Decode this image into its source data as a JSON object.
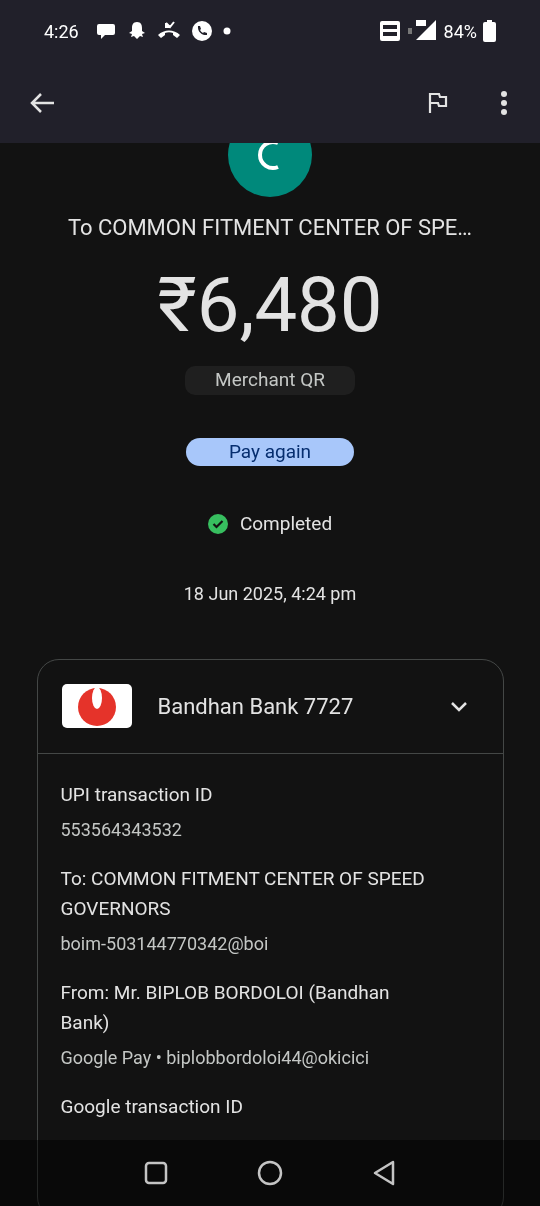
{
  "status_bar": {
    "time": "4:26",
    "battery": "84%"
  },
  "header": {
    "recipient": "To COMMON FITMENT CENTER OF SPE…",
    "amount": "₹6,480",
    "method": "Merchant QR",
    "pay_again": "Pay again",
    "status": "Completed",
    "date": "18 Jun 2025, 4:24 pm"
  },
  "account_card": {
    "bank": "Bandhan Bank 7727",
    "expanded": true,
    "details": [
      {
        "label": "UPI transaction ID",
        "value": "553564343532"
      },
      {
        "label": "To: COMMON FITMENT CENTER OF SPEED GOVERNORS",
        "value": "boim-503144770342@boi"
      },
      {
        "label": "From: Mr. BIPLOB BORDOLOI (Bandhan Bank)",
        "value": "Google Pay • biplobbordoloi44@okicici"
      },
      {
        "label": "Google transaction ID"
      }
    ]
  }
}
